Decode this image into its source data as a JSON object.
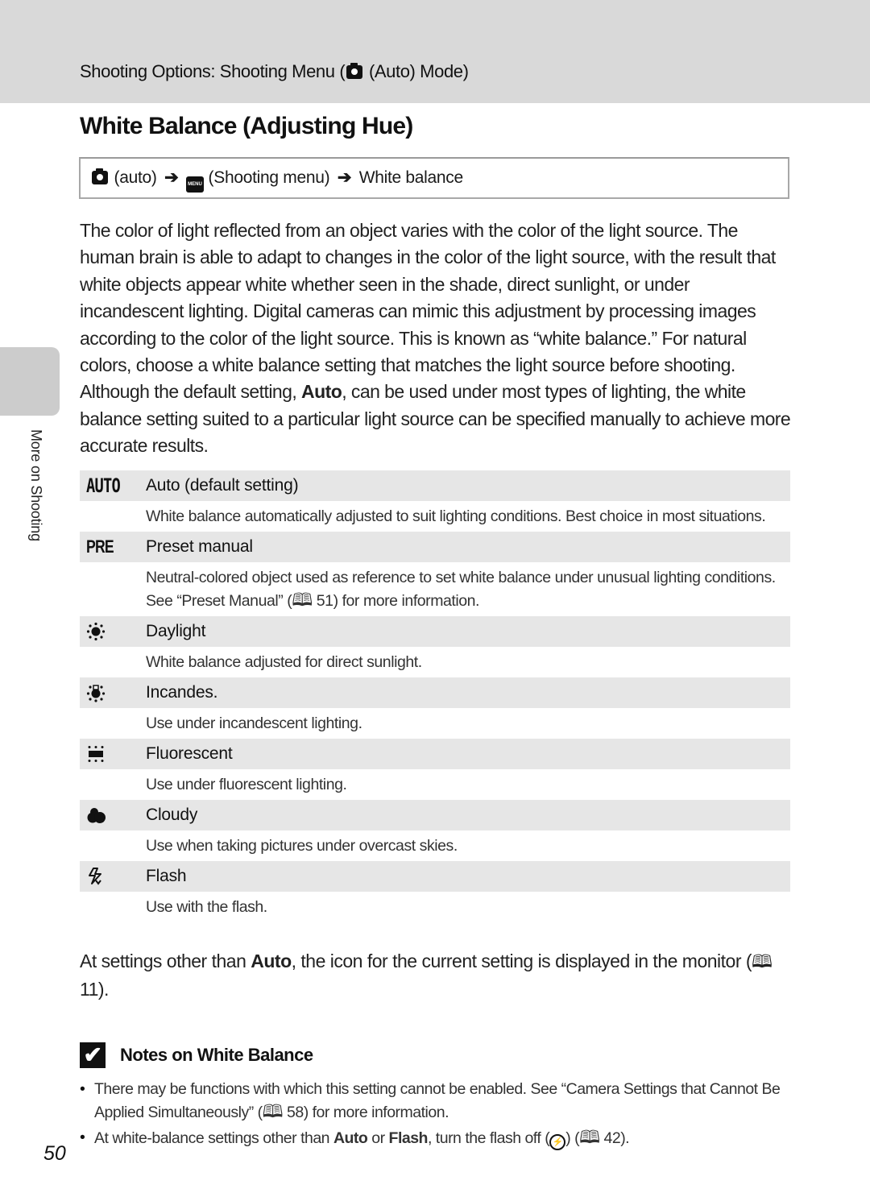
{
  "header": {
    "prefix": "Shooting Options: Shooting Menu (",
    "icon": "camera-icon",
    "suffix": " (Auto) Mode)"
  },
  "title": "White Balance (Adjusting Hue)",
  "nav_path": {
    "step1_icon": "camera-icon",
    "step1": "(auto)",
    "step2_icon": "menu-icon",
    "step2_icon_label": "MENU",
    "step2": "(Shooting menu)",
    "step3": "White balance",
    "arrow": "➔"
  },
  "intro": {
    "text_before_bold": "The color of light reflected from an object varies with the color of the light source. The human brain is able to adapt to changes in the color of the light source, with the result that white objects appear white whether seen in the shade, direct sunlight, or under incandescent lighting. Digital cameras can mimic this adjustment by processing images according to the color of the light source. This is known as “white balance.” For natural colors, choose a white balance setting that matches the light source before shooting. Although the default setting, ",
    "bold": "Auto",
    "text_after_bold": ", can be used under most types of lighting, the white balance setting suited to a particular light source can be specified manually to achieve more accurate results."
  },
  "side_tab": {
    "label": "More on Shooting"
  },
  "settings": [
    {
      "icon": "auto-wb-icon",
      "glyph": "AUTO",
      "name": "Auto (default setting)",
      "desc": "White balance automatically adjusted to suit lighting conditions. Best choice in most situations."
    },
    {
      "icon": "preset-manual-icon",
      "glyph": "PRE",
      "name": "Preset manual",
      "desc_before_ref": "Neutral-colored object used as reference to set white balance under unusual lighting conditions. See “Preset Manual” (",
      "ref": "51",
      "desc_after_ref": ") for more information."
    },
    {
      "icon": "daylight-icon",
      "name": "Daylight",
      "desc": "White balance adjusted for direct sunlight."
    },
    {
      "icon": "incandescent-icon",
      "name": "Incandes.",
      "desc": "Use under incandescent lighting."
    },
    {
      "icon": "fluorescent-icon",
      "name": "Fluorescent",
      "desc": "Use under fluorescent lighting."
    },
    {
      "icon": "cloudy-icon",
      "name": "Cloudy",
      "desc": "Use when taking pictures under overcast skies."
    },
    {
      "icon": "flash-icon",
      "name": "Flash",
      "desc": "Use with the flash."
    }
  ],
  "after_table": {
    "before_bold": "At settings other than ",
    "bold": "Auto",
    "after_bold": ", the icon for the current setting is displayed in the monitor (",
    "ref": "11",
    "end": ")."
  },
  "notes": {
    "title": "Notes on White Balance",
    "check_glyph": "✔",
    "items": [
      {
        "before_ref": "There may be functions with which this setting cannot be enabled. See “Camera Settings that Cannot Be Applied Simultaneously” (",
        "ref": "58",
        "after_ref": ") for more information."
      },
      {
        "t1": "At white-balance settings other than ",
        "b1": "Auto",
        "t2": " or ",
        "b2": "Flash",
        "t3": ", turn the flash off (",
        "t4": ") (",
        "ref": "42",
        "t5": ")."
      }
    ]
  },
  "book_glyph": "🕮",
  "page_number": "50"
}
